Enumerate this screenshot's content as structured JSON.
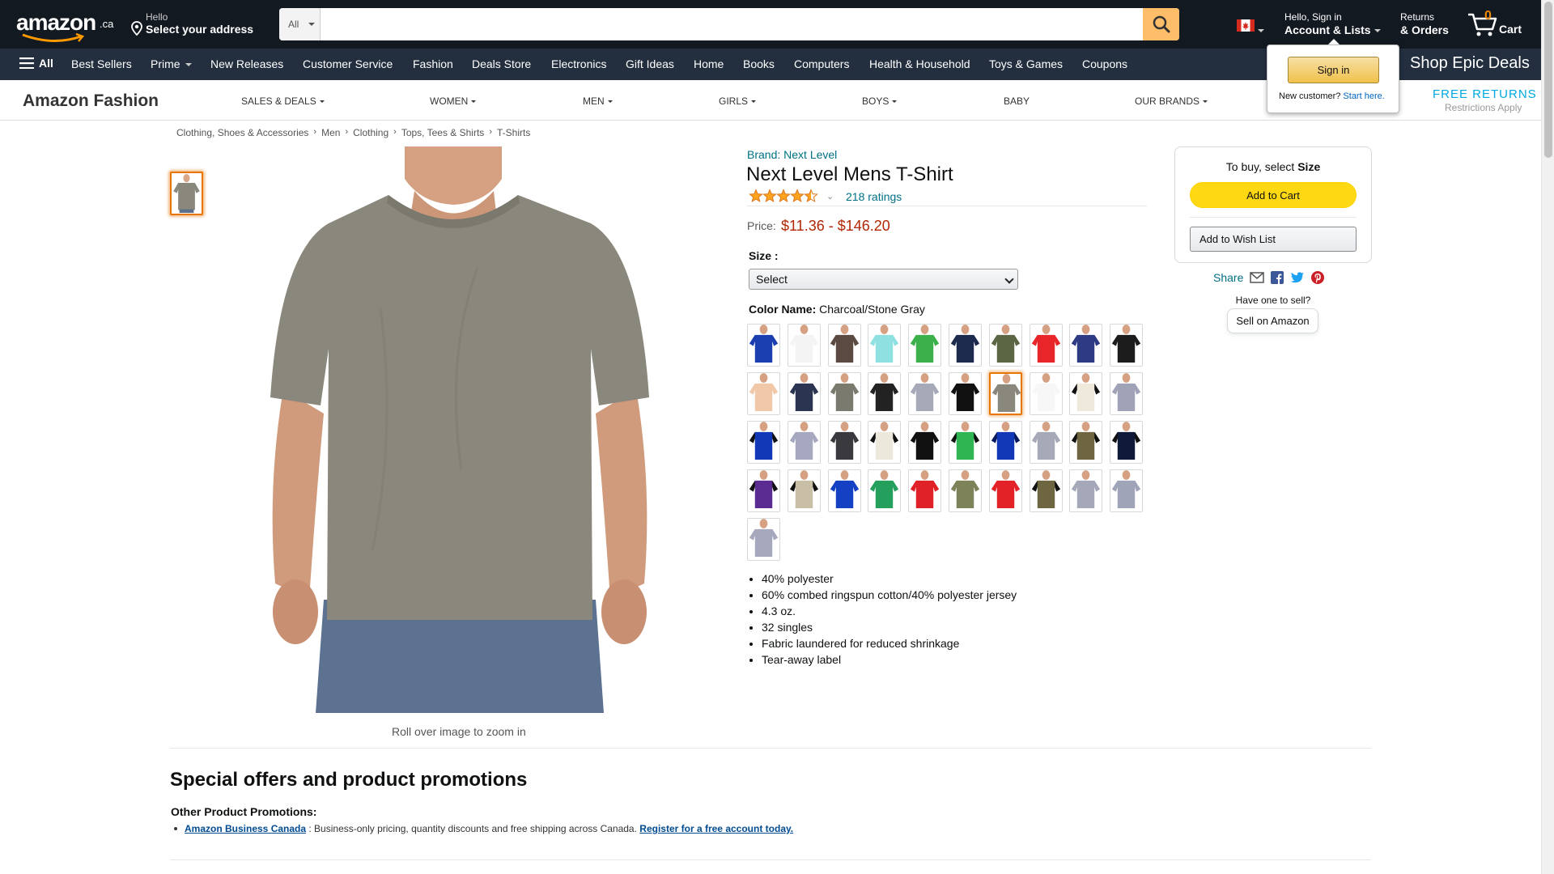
{
  "header": {
    "logo": "amazon",
    "logo_suffix": ".ca",
    "deliver_line1": "Hello",
    "deliver_line2": "Select your address",
    "search_category": "All",
    "search_placeholder": "",
    "account_line1": "Hello, Sign in",
    "account_line2": "Account & Lists",
    "returns_line1": "Returns",
    "returns_line2": "& Orders",
    "cart_count": "0",
    "cart_label": "Cart"
  },
  "nav": {
    "all_label": "All",
    "links": [
      "Best Sellers",
      "Prime",
      "New Releases",
      "Customer Service",
      "Fashion",
      "Deals Store",
      "Electronics",
      "Gift Ideas",
      "Home",
      "Books",
      "Computers",
      "Health & Household",
      "Toys & Games",
      "Coupons"
    ],
    "promo": "Shop Epic Deals"
  },
  "flyout": {
    "signin_label": "Sign in",
    "new_customer": "New customer?",
    "start_here": "Start here."
  },
  "fashion": {
    "title": "Amazon Fashion",
    "links": [
      "SALES & DEALS",
      "WOMEN",
      "MEN",
      "GIRLS",
      "BOYS",
      "BABY",
      "OUR BRANDS"
    ],
    "free_returns": "FREE RETURNS",
    "restrictions": "Restrictions Apply"
  },
  "breadcrumb": [
    "Clothing, Shoes & Accessories",
    "Men",
    "Clothing",
    "Tops, Tees & Shirts",
    "T-Shirts"
  ],
  "product": {
    "brand": "Brand: Next Level",
    "title": "Next Level Mens T-Shirt",
    "rating": 4.5,
    "ratings_count": "218 ratings",
    "price_label": "Price:",
    "price": "$11.36 - $146.20",
    "size_label": "Size :",
    "size_value": "Select",
    "color_label": "Color Name:",
    "color_value": "Charcoal/Stone Gray",
    "rollover": "Roll over image to zoom in",
    "main_color": "#8a877c",
    "swatches": [
      {
        "body": "#1b3fb0",
        "sleeve": "#1b3fb0"
      },
      {
        "body": "#f4f4f4",
        "sleeve": "#f4f4f4"
      },
      {
        "body": "#5b4a42",
        "sleeve": "#5b4a42"
      },
      {
        "body": "#8fe0e0",
        "sleeve": "#8fe0e0"
      },
      {
        "body": "#3bb04b",
        "sleeve": "#3bb04b"
      },
      {
        "body": "#1c2a4d",
        "sleeve": "#1c2a4d"
      },
      {
        "body": "#5c6644",
        "sleeve": "#5c6644"
      },
      {
        "body": "#e8262a",
        "sleeve": "#e8262a"
      },
      {
        "body": "#2d3a84",
        "sleeve": "#2d3a84"
      },
      {
        "body": "#1c1c1c",
        "sleeve": "#1c1c1c"
      },
      {
        "body": "#f2c9a8",
        "sleeve": "#f2c9a8"
      },
      {
        "body": "#2b3552",
        "sleeve": "#2b3552"
      },
      {
        "body": "#7a7a6e",
        "sleeve": "#7a7a6e"
      },
      {
        "body": "#222",
        "sleeve": "#222"
      },
      {
        "body": "#a6a9b8",
        "sleeve": "#a6a9b8"
      },
      {
        "body": "#111",
        "sleeve": "#111"
      },
      {
        "body": "#8a877c",
        "sleeve": "#8a877c"
      },
      {
        "body": "#f7f7f7",
        "sleeve": "#f7f7f7"
      },
      {
        "body": "#efe9dc",
        "sleeve": "#111"
      },
      {
        "body": "#a0a3b8",
        "sleeve": "#a0a3b8"
      },
      {
        "body": "#1238b8",
        "sleeve": "#111"
      },
      {
        "body": "#a6a8c0",
        "sleeve": "#a6a8c0"
      },
      {
        "body": "#3a3a3e",
        "sleeve": "#3a3a3e"
      },
      {
        "body": "#ece8dc",
        "sleeve": "#111"
      },
      {
        "body": "#111",
        "sleeve": "#111"
      },
      {
        "body": "#2fb552",
        "sleeve": "#111"
      },
      {
        "body": "#1238b8",
        "sleeve": "#0b1a5c"
      },
      {
        "body": "#a6a9b8",
        "sleeve": "#a6a9b8"
      },
      {
        "body": "#6e6640",
        "sleeve": "#111"
      },
      {
        "body": "#0f1a3a",
        "sleeve": "#111"
      },
      {
        "body": "#5a2c91",
        "sleeve": "#111"
      },
      {
        "body": "#c9bfa7",
        "sleeve": "#111"
      },
      {
        "body": "#1440c4",
        "sleeve": "#1440c4"
      },
      {
        "body": "#25a05c",
        "sleeve": "#25a05c"
      },
      {
        "body": "#e02128",
        "sleeve": "#e02128"
      },
      {
        "body": "#7d8259",
        "sleeve": "#7d8259"
      },
      {
        "body": "#e32228",
        "sleeve": "#e32228"
      },
      {
        "body": "#6e6640",
        "sleeve": "#111"
      },
      {
        "body": "#a4a8b8",
        "sleeve": "#a4a8b8"
      },
      {
        "body": "#a0a4b8",
        "sleeve": "#a0a4b8"
      },
      {
        "body": "#a6a9bd",
        "sleeve": "#a6a9bd"
      }
    ],
    "selected_swatch": 16,
    "bullets": [
      "40% polyester",
      "60% combed ringspun cotton/40% polyester jersey",
      "4.3 oz.",
      "32 singles",
      "Fabric laundered for reduced shrinkage",
      "Tear-away label"
    ]
  },
  "buybox": {
    "to_buy_prefix": "To buy, select",
    "to_buy_bold": "Size",
    "add_to_cart": "Add to Cart",
    "wish_list": "Add to Wish List",
    "share": "Share",
    "have_one": "Have one to sell?",
    "sell": "Sell on Amazon"
  },
  "promotions": {
    "title": "Special offers and product promotions",
    "subtitle": "Other Product Promotions:",
    "link1": "Amazon Business Canada",
    "text": " : Business-only pricing, quantity discounts and free shipping across Canada. ",
    "link2": "Register for a free account today."
  },
  "colors": {
    "nav_dark": "#131921",
    "nav_sub": "#232f3e",
    "accent": "#febd69",
    "link": "#007185",
    "price": "#b12704",
    "cart_button": "#ffd814",
    "star": "#ffa41c"
  }
}
